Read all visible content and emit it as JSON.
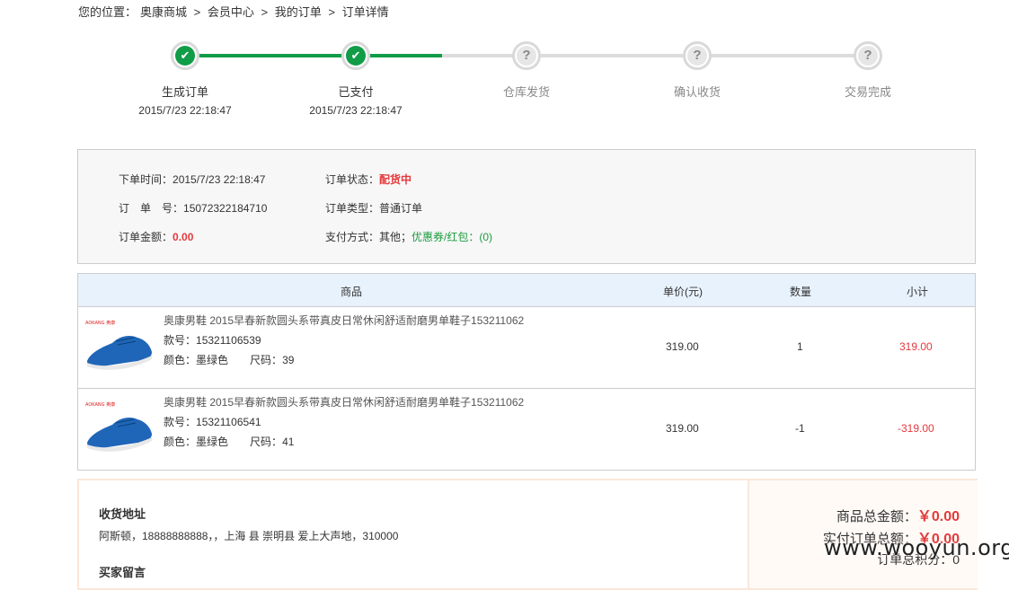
{
  "breadcrumb": {
    "prefix": "您的位置：",
    "items": [
      "奥康商城",
      ">",
      "会员中心",
      ">",
      "我的订单",
      ">",
      "订单详情"
    ]
  },
  "progress": {
    "steps": [
      {
        "label": "生成订单",
        "time": "2015/7/23 22:18:47",
        "state": "done",
        "icon": "check-icon"
      },
      {
        "label": "已支付",
        "time": "2015/7/23 22:18:47",
        "state": "done",
        "icon": "check-icon"
      },
      {
        "label": "仓库发货",
        "time": "",
        "state": "pending",
        "icon": "question-icon"
      },
      {
        "label": "确认收货",
        "time": "",
        "state": "pending",
        "icon": "question-icon"
      },
      {
        "label": "交易完成",
        "time": "",
        "state": "pending",
        "icon": "question-icon"
      }
    ],
    "check_glyph": "✔",
    "question_glyph": "?",
    "colors": {
      "done": "#119c48",
      "pending": "#e6e6e6"
    }
  },
  "order_info": {
    "order_time_label": "下单时间：",
    "order_time": "2015/7/23 22:18:47",
    "order_no_label": "订　单　号：",
    "order_no": "15072322184710",
    "amount_label": "订单金额：",
    "amount": "0.00",
    "status_label": "订单状态：",
    "status": "配货中",
    "type_label": "订单类型：",
    "type": "普通订单",
    "payment_label": "支付方式：",
    "payment": "其他；",
    "coupon": "优惠券/红包：",
    "coupon_value": "(0)"
  },
  "items_table": {
    "headers": [
      "商品",
      "单价(元)",
      "数量",
      "小计"
    ],
    "rows": [
      {
        "name": "奥康男鞋 2015早春新款圆头系带真皮日常休闲舒适耐磨男单鞋子153211062",
        "sku_label": "款号：",
        "sku": "15321106539",
        "color_label": "颜色：",
        "color": "墨绿色",
        "size_label": "尺码：",
        "size": "39",
        "price": "319.00",
        "qty": "1",
        "subtotal": "319.00",
        "brand": "AOKANG 奥康"
      },
      {
        "name": "奥康男鞋 2015早春新款圆头系带真皮日常休闲舒适耐磨男单鞋子153211062",
        "sku_label": "款号：",
        "sku": "15321106541",
        "color_label": "颜色：",
        "color": "墨绿色",
        "size_label": "尺码：",
        "size": "41",
        "price": "319.00",
        "qty": "-1",
        "subtotal": "-319.00",
        "brand": "AOKANG 奥康"
      }
    ]
  },
  "shipping": {
    "title": "收货地址",
    "address": "阿斯顿，18888888888，，上海 县 崇明县 爱上大声地，310000",
    "message_title": "买家留言"
  },
  "summary": {
    "goods_total_label": "商品总金额：",
    "goods_total": "￥0.00",
    "paid_total_label": "实付订单总额：",
    "paid_total": "￥0.00",
    "points_label": "订单总积分：",
    "points": "0"
  },
  "watermark": "www.wooyun.org"
}
